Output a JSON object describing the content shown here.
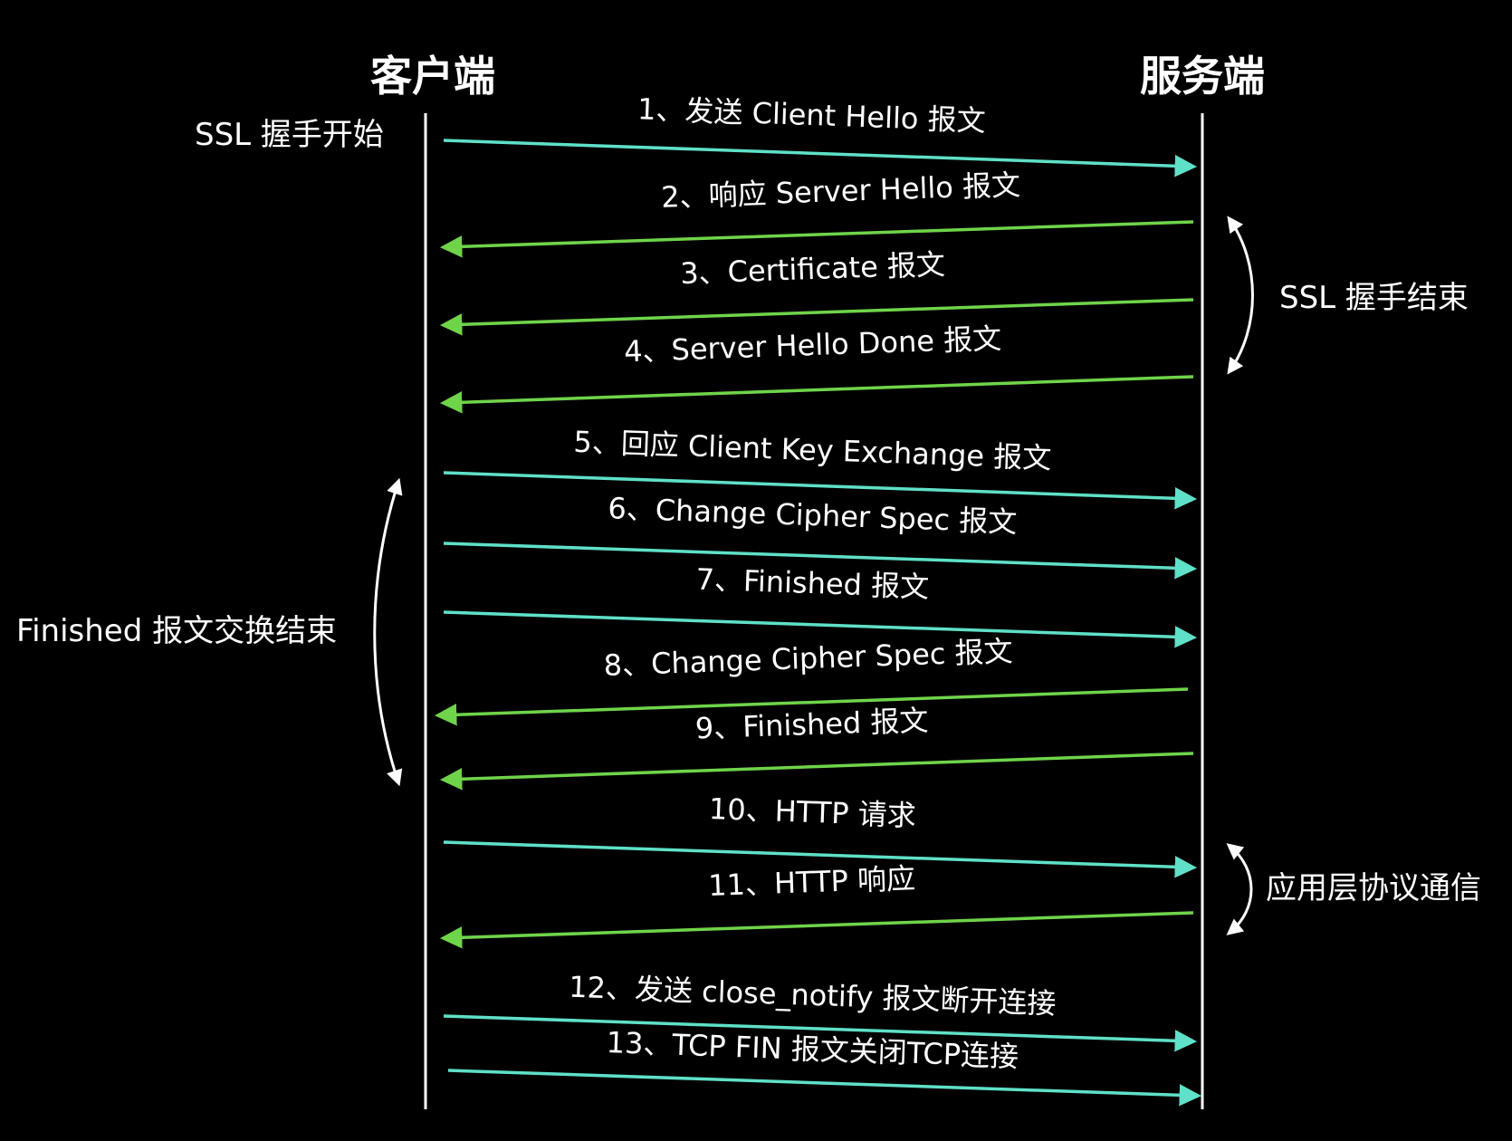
{
  "actors": {
    "client": "客户端",
    "server": "服务端"
  },
  "colors": {
    "background": "#000000",
    "to_server": "#5fe0c8",
    "to_client": "#6fd44a",
    "text": "#ffffff"
  },
  "messages": [
    {
      "text": "1、发送 Client Hello 报文",
      "direction": "to_server"
    },
    {
      "text": "2、响应 Server Hello 报文",
      "direction": "to_client"
    },
    {
      "text": "3、Certificate 报文",
      "direction": "to_client"
    },
    {
      "text": "4、Server Hello Done 报文",
      "direction": "to_client"
    },
    {
      "text": "5、回应 Client Key Exchange 报文",
      "direction": "to_server"
    },
    {
      "text": "6、Change Cipher Spec 报文",
      "direction": "to_server"
    },
    {
      "text": "7、Finished 报文",
      "direction": "to_server"
    },
    {
      "text": "8、Change Cipher Spec 报文",
      "direction": "to_client"
    },
    {
      "text": "9、Finished 报文",
      "direction": "to_client"
    },
    {
      "text": "10、HTTP 请求",
      "direction": "to_server"
    },
    {
      "text": "11、HTTP 响应",
      "direction": "to_client"
    },
    {
      "text": "12、发送 close_notify 报文断开连接",
      "direction": "to_server"
    },
    {
      "text": "13、TCP FIN 报文关闭TCP连接",
      "direction": "to_server"
    }
  ],
  "annotations": {
    "ssl_start": "SSL 握手开始",
    "ssl_end": "SSL 握手结束",
    "finished_exchange": "Finished 报文交换结束",
    "app_protocol": "应用层协议通信"
  }
}
